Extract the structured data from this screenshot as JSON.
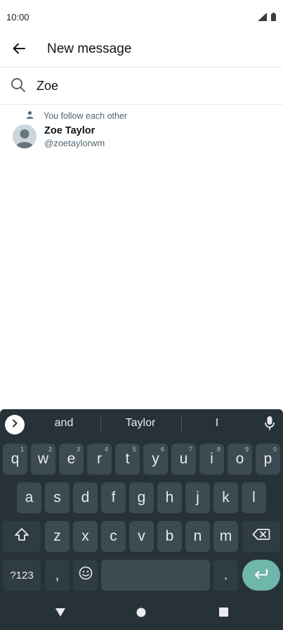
{
  "status_bar": {
    "time": "10:00"
  },
  "header": {
    "title": "New message"
  },
  "search": {
    "value": "Zoe"
  },
  "result": {
    "social_context": "You follow each other",
    "name": "Zoe Taylor",
    "handle": "@zoetaylorwm"
  },
  "keyboard": {
    "suggestions": [
      "and",
      "Taylor",
      "I"
    ],
    "row1": [
      {
        "k": "q",
        "h": "1"
      },
      {
        "k": "w",
        "h": "2"
      },
      {
        "k": "e",
        "h": "3"
      },
      {
        "k": "r",
        "h": "4"
      },
      {
        "k": "t",
        "h": "5"
      },
      {
        "k": "y",
        "h": "6"
      },
      {
        "k": "u",
        "h": "7"
      },
      {
        "k": "i",
        "h": "8"
      },
      {
        "k": "o",
        "h": "9"
      },
      {
        "k": "p",
        "h": "0"
      }
    ],
    "row2": [
      "a",
      "s",
      "d",
      "f",
      "g",
      "h",
      "j",
      "k",
      "l"
    ],
    "row3": [
      "z",
      "x",
      "c",
      "v",
      "b",
      "n",
      "m"
    ],
    "symbols_label": "?123",
    "comma": ",",
    "period": "."
  },
  "colors": {
    "keyboard_bg": "#263238",
    "key_bg": "#3c4a51",
    "enter_key": "#6fb6ab"
  }
}
